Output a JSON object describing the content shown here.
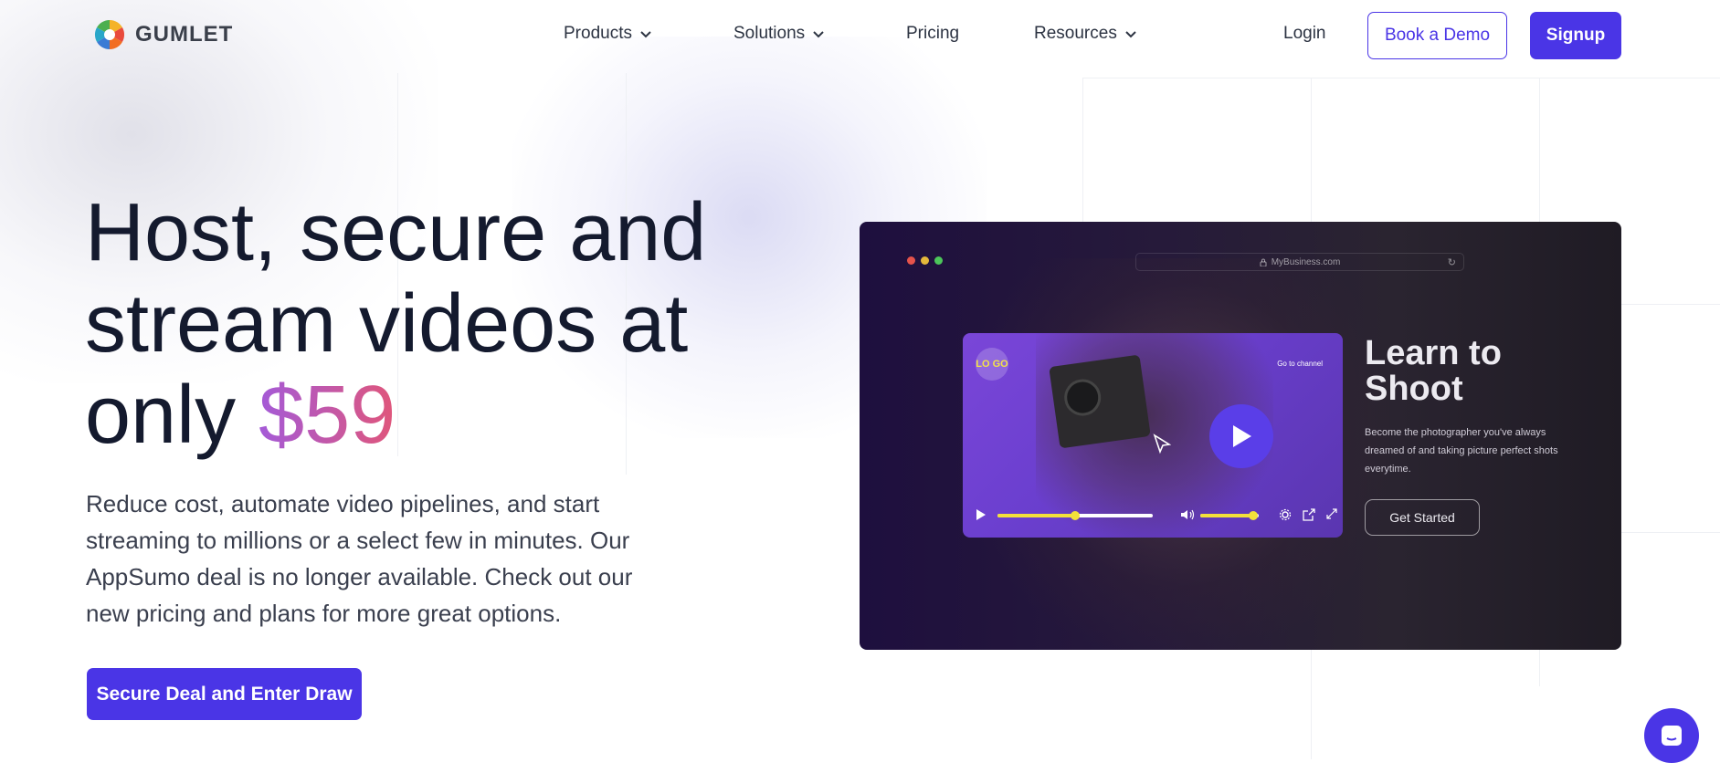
{
  "nav": {
    "brand": "GUMLET",
    "items": [
      {
        "label": "Products",
        "has_dropdown": true
      },
      {
        "label": "Solutions",
        "has_dropdown": true
      },
      {
        "label": "Pricing",
        "has_dropdown": false
      },
      {
        "label": "Resources",
        "has_dropdown": true
      }
    ],
    "login_label": "Login",
    "demo_label": "Book a Demo",
    "signup_label": "Signup"
  },
  "hero": {
    "title_part1": "Host, secure and stream videos at only ",
    "price": "$59",
    "description": "Reduce cost, automate video pipelines, and start streaming to millions or a select few in minutes. Our AppSumo deal is no longer available. Check out our new pricing and plans for more great options.",
    "cta_label": "Secure Deal and Enter Draw"
  },
  "video_preview": {
    "url": "MyBusiness.com",
    "player_logo": "LO GO",
    "go_to_channel": "Go to channel",
    "progress": 0.5,
    "volume": 0.9,
    "headline": "Learn to Shoot",
    "subtext": "Become the photographer you've always dreamed of and taking picture perfect shots everytime.",
    "button_label": "Get Started"
  },
  "colors": {
    "primary": "#4a35e6",
    "price_gradient_start": "#a45ad8",
    "price_gradient_end": "#e0567a",
    "player_accent": "#f3e03a"
  },
  "icons": {
    "chevron": "chevron-down-icon",
    "chat": "chat-icon",
    "play": "play-icon"
  }
}
